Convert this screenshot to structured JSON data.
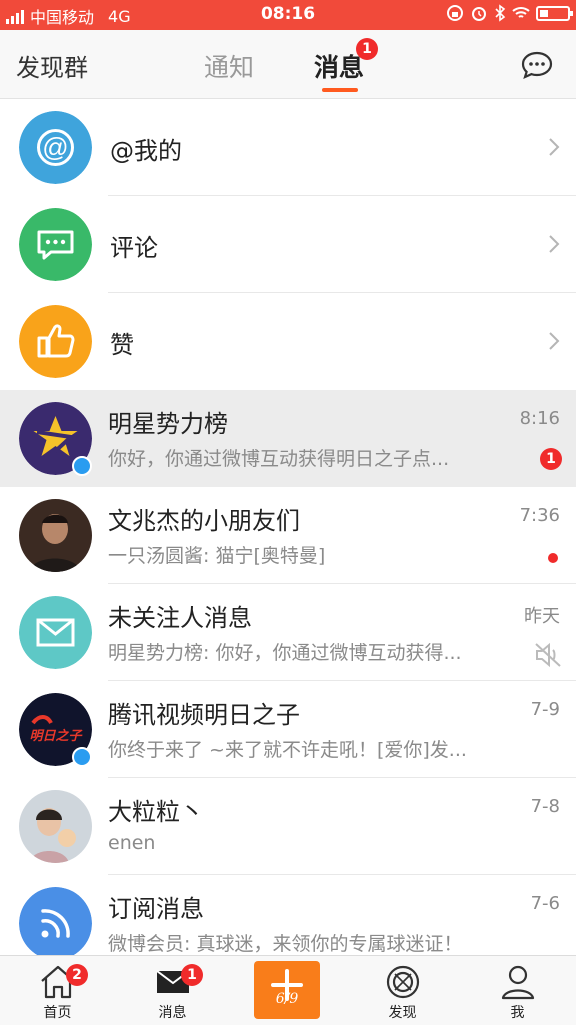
{
  "status_bar": {
    "carrier": "中国移动",
    "network": "4G",
    "time": "08:16"
  },
  "top_nav": {
    "left_label": "发现群",
    "tabs": [
      {
        "label": "通知",
        "active": false
      },
      {
        "label": "消息",
        "active": true,
        "badge": "1"
      }
    ],
    "right_icon": "chat-bubble-icon"
  },
  "colors": {
    "status_bar": "#f14a3a",
    "accent_orange": "#ff5a1f",
    "badge_red": "#f02b2b",
    "at_blue": "#3fa4dc",
    "comment_green": "#39b969",
    "like_orange": "#f9a31a"
  },
  "shortcuts": [
    {
      "label": "@我的",
      "icon": "at-icon"
    },
    {
      "label": "评论",
      "icon": "comment-icon"
    },
    {
      "label": "赞",
      "icon": "thumbs-up-icon"
    }
  ],
  "conversations": [
    {
      "title": "明星势力榜",
      "preview": "你好，你通过微博互动获得明日之子点...",
      "time": "8:16",
      "badge": "1",
      "verified": true
    },
    {
      "title": "文兆杰的小朋友们",
      "preview": "一只汤圆酱: 猫宁[奥特曼]",
      "time": "7:36",
      "red_dot": true
    },
    {
      "title": "未关注人消息",
      "preview": "明星势力榜: 你好，你通过微博互动获得...",
      "time": "昨天",
      "muted": true
    },
    {
      "title": "腾讯视频明日之子",
      "preview": "你终于来了 ~来了就不许走吼！[爱你]发...",
      "time": "7-9",
      "verified": true,
      "avatar_text": "明日之子"
    },
    {
      "title": "大粒粒丶",
      "preview": "enen",
      "time": "7-8"
    },
    {
      "title": "订阅消息",
      "preview": "微博会员: 真球迷，来领你的专属球迷证！",
      "time": "7-6"
    }
  ],
  "bottom_nav": {
    "items": [
      {
        "label": "首页",
        "icon": "home-icon",
        "badge": "2"
      },
      {
        "label": "消息",
        "icon": "mail-icon",
        "badge": "1"
      },
      {
        "label": "发现",
        "icon": "discover-icon"
      },
      {
        "label": "我",
        "icon": "profile-icon"
      }
    ],
    "compose_label": "6/9"
  }
}
